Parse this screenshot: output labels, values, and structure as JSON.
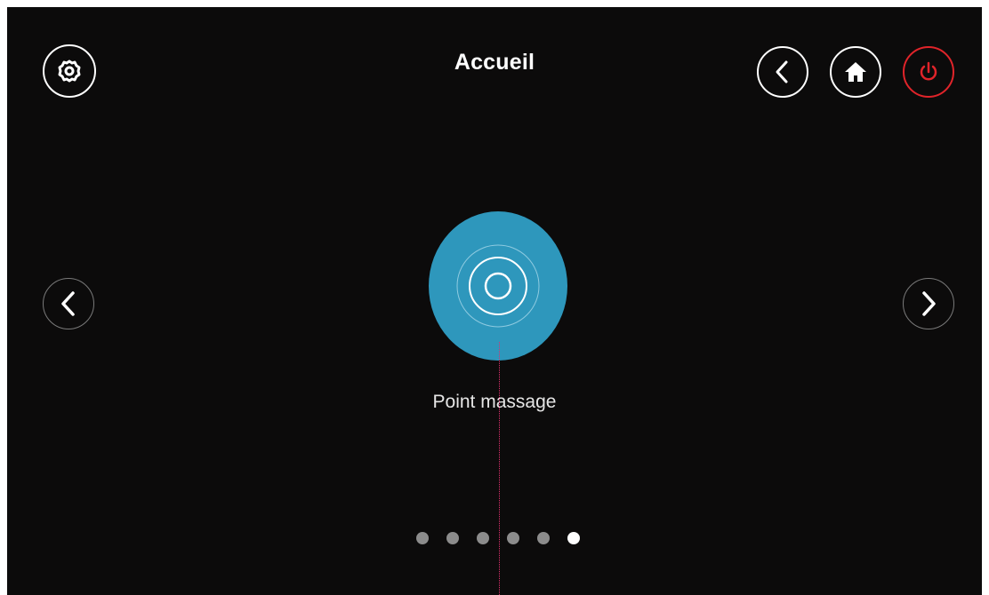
{
  "header": {
    "title": "Accueil"
  },
  "feature": {
    "label": "Point massage",
    "color": "#2e97bc"
  },
  "icons": {
    "settings": "gear-icon",
    "back": "chevron-left-icon",
    "home": "home-icon",
    "power": "power-icon",
    "previous": "chevron-left-icon",
    "next": "chevron-right-icon"
  },
  "colors": {
    "background": "#0c0b0b",
    "accent": "#2e97bc",
    "power": "#e0242a",
    "guide": "#e0306e"
  },
  "pager": {
    "count": 6,
    "active_index": 5
  }
}
